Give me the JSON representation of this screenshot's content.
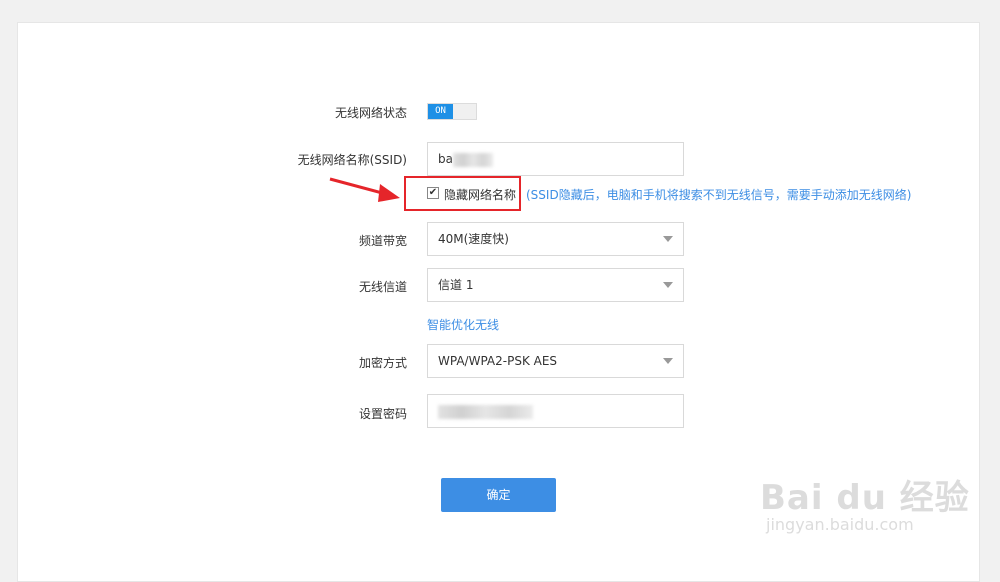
{
  "form": {
    "wifi_status_label": "无线网络状态",
    "wifi_status_value": "ON",
    "ssid_label": "无线网络名称(SSID)",
    "ssid_value": "ba",
    "hide_ssid_label": "隐藏网络名称",
    "hide_ssid_checked": true,
    "hide_ssid_hint": "(SSID隐藏后，电脑和手机将搜索不到无线信号，需要手动添加无线网络)",
    "bandwidth_label": "频道带宽",
    "bandwidth_value": "40M(速度快)",
    "channel_label": "无线信道",
    "channel_value": "信道 1",
    "optimize_link": "智能优化无线",
    "encryption_label": "加密方式",
    "encryption_value": "WPA/WPA2-PSK AES",
    "password_label": "设置密码",
    "submit_label": "确定"
  },
  "watermark": {
    "brand": "Bai du 经验",
    "url": "jingyan.baidu.com"
  },
  "colors": {
    "accent": "#3d8ee4",
    "toggle_on": "#1e90e6",
    "highlight": "#e5252a"
  }
}
